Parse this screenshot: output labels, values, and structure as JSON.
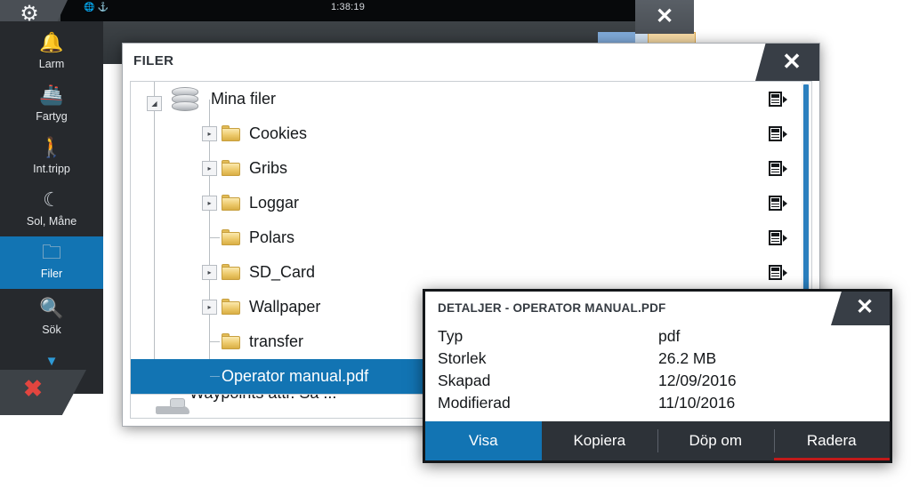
{
  "background_app": {
    "time": "1:38:19",
    "status_icons": [
      "globe-icon",
      "anchor-icon"
    ],
    "gear_icon": "gear-icon",
    "close_label": "✕"
  },
  "sidebar": {
    "items": [
      {
        "label": "Larm",
        "icon": "bell-icon",
        "active": false
      },
      {
        "label": "Fartyg",
        "icon": "ship-icon",
        "active": false
      },
      {
        "label": "Int.tripp",
        "icon": "trip-icon",
        "active": false
      },
      {
        "label": "Sol, Måne",
        "icon": "sun-moon-icon",
        "active": false
      },
      {
        "label": "Filer",
        "icon": "folder-icon",
        "active": true
      },
      {
        "label": "Sök",
        "icon": "search-icon",
        "active": false
      }
    ],
    "more_chevron": "▼",
    "mob_button": "✖"
  },
  "filer_window": {
    "title": "FILER",
    "close_label": "✕",
    "tree": [
      {
        "name": "Mina filer",
        "type": "root",
        "expanded": true,
        "indent": 0,
        "has_toggle": true,
        "selected": false
      },
      {
        "name": "Cookies",
        "type": "folder",
        "expanded": false,
        "indent": 1,
        "has_toggle": true,
        "selected": false
      },
      {
        "name": "Gribs",
        "type": "folder",
        "expanded": false,
        "indent": 1,
        "has_toggle": true,
        "selected": false
      },
      {
        "name": "Loggar",
        "type": "folder",
        "expanded": false,
        "indent": 1,
        "has_toggle": true,
        "selected": false
      },
      {
        "name": "Polars",
        "type": "folder",
        "expanded": false,
        "indent": 1,
        "has_toggle": false,
        "selected": false
      },
      {
        "name": "SD_Card",
        "type": "folder",
        "expanded": false,
        "indent": 1,
        "has_toggle": true,
        "selected": false
      },
      {
        "name": "Wallpaper",
        "type": "folder",
        "expanded": false,
        "indent": 1,
        "has_toggle": true,
        "selected": false
      },
      {
        "name": "transfer",
        "type": "folder",
        "expanded": false,
        "indent": 1,
        "has_toggle": false,
        "selected": false
      },
      {
        "name": "Operator manual.pdf",
        "type": "file",
        "expanded": false,
        "indent": 1,
        "has_toggle": false,
        "selected": true
      }
    ],
    "partial_row": {
      "name": "Waypoints attr. Så ..."
    },
    "detail_icon": "document-details-icon",
    "scrollbar": "vertical-scrollbar"
  },
  "details_window": {
    "title": "DETALJER - OPERATOR MANUAL.PDF",
    "close_label": "✕",
    "rows": [
      {
        "key": "Typ",
        "value": "pdf"
      },
      {
        "key": "Storlek",
        "value": "26.2 MB"
      },
      {
        "key": "Skapad",
        "value": "12/09/2016"
      },
      {
        "key": "Modifierad",
        "value": "11/10/2016"
      }
    ],
    "buttons": [
      {
        "label": "Visa",
        "style": "primary"
      },
      {
        "label": "Kopiera",
        "style": "normal"
      },
      {
        "label": "Döp om",
        "style": "normal"
      },
      {
        "label": "Radera",
        "style": "danger"
      }
    ]
  },
  "colors": {
    "accent_blue": "#1274b3",
    "dark_panel": "#2d3238",
    "sidebar_bg": "#26292d",
    "danger_red": "#c11a1a",
    "folder_yellow": "#ecc96a"
  }
}
